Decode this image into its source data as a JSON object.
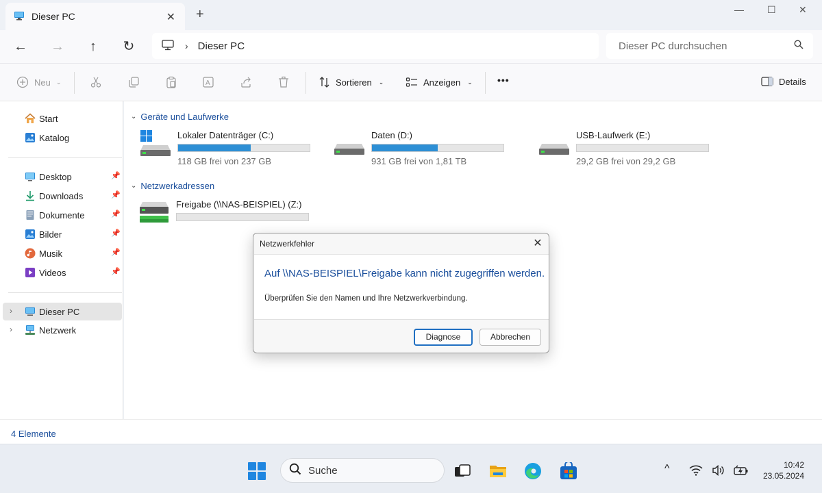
{
  "window": {
    "tab_title": "Dieser PC",
    "tab_close": "✕",
    "new_tab": "+",
    "minimize": "—",
    "maximize": "☐",
    "close": "✕"
  },
  "nav": {
    "back": "←",
    "forward": "→",
    "up": "↑",
    "refresh": "↻",
    "breadcrumb_sep": "›",
    "address": "Dieser PC",
    "search_placeholder": "Dieser PC durchsuchen"
  },
  "commands": {
    "new": "Neu",
    "sort": "Sortieren",
    "view": "Anzeigen",
    "more": "•••",
    "details": "Details"
  },
  "sidebar": {
    "quick": [
      {
        "label": "Start",
        "icon": "home-icon"
      },
      {
        "label": "Katalog",
        "icon": "gallery-icon"
      }
    ],
    "pinned": [
      {
        "label": "Desktop",
        "icon": "desktop-icon"
      },
      {
        "label": "Downloads",
        "icon": "download-icon"
      },
      {
        "label": "Dokumente",
        "icon": "documents-icon"
      },
      {
        "label": "Bilder",
        "icon": "pictures-icon"
      },
      {
        "label": "Musik",
        "icon": "music-icon"
      },
      {
        "label": "Videos",
        "icon": "videos-icon"
      }
    ],
    "locations": [
      {
        "label": "Dieser PC",
        "icon": "computer-icon",
        "selected": true
      },
      {
        "label": "Netzwerk",
        "icon": "network-icon",
        "selected": false
      }
    ],
    "pin_glyph": "📌",
    "chevron_glyph": "›"
  },
  "groups": {
    "devices": "Geräte und Laufwerke",
    "network": "Netzwerkadressen"
  },
  "drives": [
    {
      "name": "Lokaler Datenträger (C:)",
      "free": "118 GB frei von 237 GB",
      "used_fraction": 0.55
    },
    {
      "name": "Daten (D:)",
      "free": "931 GB frei von 1,81 TB",
      "used_fraction": 0.5
    },
    {
      "name": "USB-Laufwerk (E:)",
      "free": "29,2 GB frei von 29,2 GB",
      "used_fraction": 0.0
    }
  ],
  "network_drives": [
    {
      "name": "Freigabe (\\\\NAS-BEISPIEL) (Z:)",
      "used_fraction": 0.0
    }
  ],
  "status": {
    "item_count": "4 Elemente"
  },
  "dialog": {
    "title": "Netzwerkfehler",
    "close": "✕",
    "heading": "Auf \\\\NAS-BEISPIEL\\Freigabe kann nicht zugegriffen werden.",
    "message": "Überprüfen Sie den Namen und Ihre Netzwerkverbindung.",
    "primary_button": "Diagnose",
    "secondary_button": "Abbrechen"
  },
  "taskbar": {
    "search_label": "Suche",
    "tray_chevron": "^",
    "time": "10:42",
    "date": "23.05.2024"
  },
  "colors": {
    "accent": "#1b4f9c",
    "drive_bar": "#2d8fd5",
    "primary_border": "#1f6fc2"
  }
}
